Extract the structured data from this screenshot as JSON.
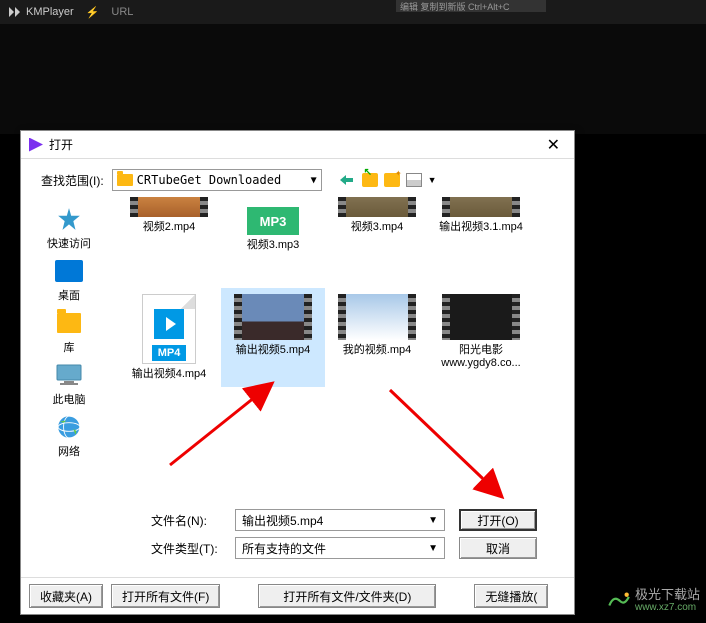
{
  "kmplayer": {
    "name": "KMPlayer",
    "url_label": "URL"
  },
  "top_strip": "编辑 复制到新版  Ctrl+Alt+C",
  "dialog": {
    "title": "打开",
    "lookup_label": "查找范围(I):",
    "folder_name": "CRTubeGet Downloaded",
    "sidebar": [
      {
        "key": "quick",
        "label": "快速访问"
      },
      {
        "key": "desktop",
        "label": "桌面"
      },
      {
        "key": "lib",
        "label": "库"
      },
      {
        "key": "pc",
        "label": "此电脑"
      },
      {
        "key": "net",
        "label": "网络"
      }
    ],
    "files_row1": [
      {
        "name": "视频2.mp4",
        "type": "video-orange"
      },
      {
        "name": "视频3.mp3",
        "type": "mp3"
      },
      {
        "name": "视频3.mp4",
        "type": "video-sunset"
      },
      {
        "name": "输出视频3.1.mp4",
        "type": "video-sunset"
      }
    ],
    "files_row2": [
      {
        "name": "输出视频4.mp4",
        "type": "mp4-doc"
      },
      {
        "name": "输出视频5.mp4",
        "type": "video-sky",
        "selected": true
      },
      {
        "name": "我的视频.mp4",
        "type": "video-snow"
      },
      {
        "name": "阳光电影\nwww.ygdy8.co...",
        "type": "video-dark"
      }
    ],
    "filename_label": "文件名(N):",
    "filename_value": "输出视频5.mp4",
    "filetype_label": "文件类型(T):",
    "filetype_value": "所有支持的文件",
    "open_btn": "打开(O)",
    "cancel_btn": "取消",
    "bottom_buttons": [
      "收藏夹(A)",
      "打开所有文件(F)",
      "打开所有文件/文件夹(D)",
      "无缝播放("
    ],
    "mp3_badge": "MP3",
    "mp4_badge": "MP4"
  },
  "watermark": {
    "title": "极光下载站",
    "url": "www.xz7.com"
  }
}
